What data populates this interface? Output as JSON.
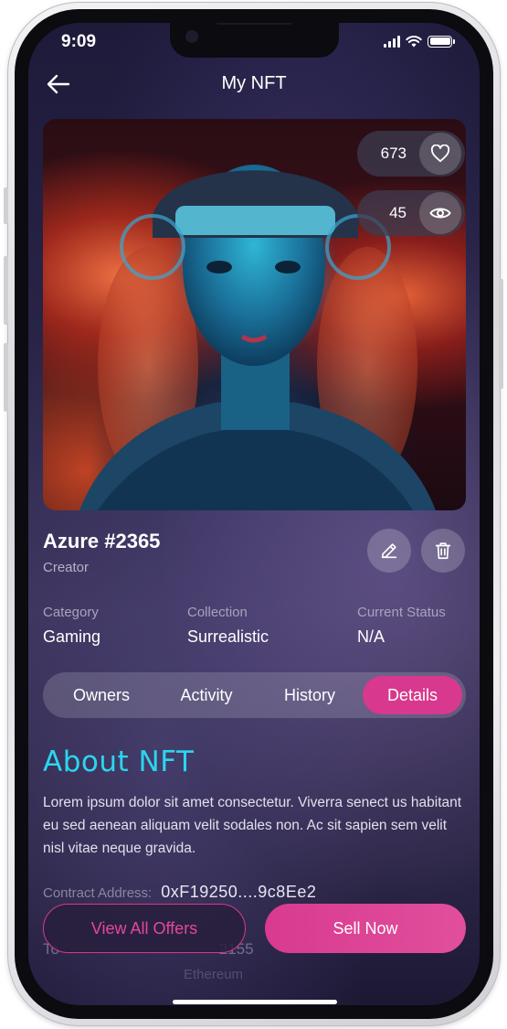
{
  "status_bar": {
    "time": "9:09"
  },
  "header": {
    "title": "My NFT"
  },
  "nft": {
    "likes": "673",
    "views": "45",
    "name": "Azure #2365",
    "creator_label": "Creator"
  },
  "details": [
    {
      "label": "Category",
      "value": "Gaming"
    },
    {
      "label": "Collection",
      "value": "Surrealistic"
    },
    {
      "label": "Current Status",
      "value": "N/A"
    }
  ],
  "tabs": [
    {
      "label": "Owners",
      "active": false
    },
    {
      "label": "Activity",
      "active": false
    },
    {
      "label": "History",
      "active": false
    },
    {
      "label": "Details",
      "active": true
    }
  ],
  "about": {
    "title": "About NFT",
    "body": "Lorem ipsum dolor sit amet consectetur. Viverra senect us habitant eu sed aenean aliquam velit sodales non. Ac sit sapien sem velit nisl vitae neque gravida.",
    "contract_label": "Contract Address:",
    "contract_value": "0xF19250....9c8Ee2",
    "partial_row": "To",
    "partial_row_value": "2155",
    "partial_row2": "Ethereum"
  },
  "actions": {
    "view_offers": "View All Offers",
    "sell_now": "Sell Now"
  },
  "colors": {
    "accent_pink": "#d8388d",
    "accent_cyan": "#2bd6ee",
    "background": "#2a2548"
  }
}
